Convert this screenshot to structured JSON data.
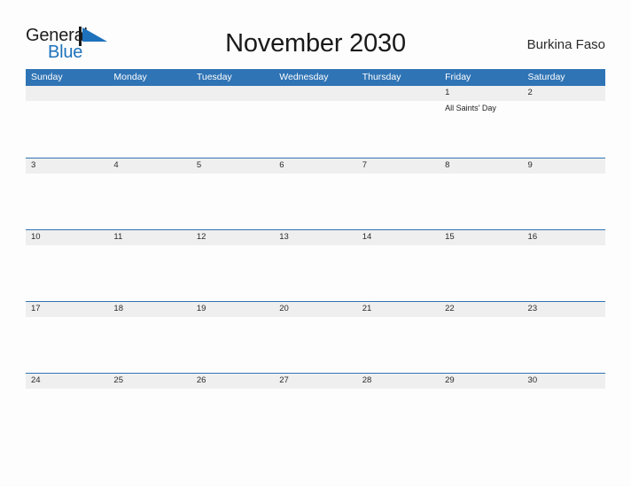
{
  "logo": {
    "text_primary": "General",
    "text_secondary": "Blue",
    "mark": "blue-flag-triangle",
    "color_primary": "#1d1d1d",
    "color_secondary": "#1d72bb"
  },
  "header": {
    "title": "November 2030",
    "country": "Burkina Faso"
  },
  "theme": {
    "accent": "#2f74b5",
    "band": "#efefef",
    "page_background": "#fdfdfd",
    "header_text": "#ffffff"
  },
  "calendar": {
    "month": "November",
    "year": "2030",
    "weekdays": [
      "Sunday",
      "Monday",
      "Tuesday",
      "Wednesday",
      "Thursday",
      "Friday",
      "Saturday"
    ],
    "weeks": [
      [
        {
          "day": "",
          "events": []
        },
        {
          "day": "",
          "events": []
        },
        {
          "day": "",
          "events": []
        },
        {
          "day": "",
          "events": []
        },
        {
          "day": "",
          "events": []
        },
        {
          "day": "1",
          "events": [
            "All Saints' Day"
          ]
        },
        {
          "day": "2",
          "events": []
        }
      ],
      [
        {
          "day": "3",
          "events": []
        },
        {
          "day": "4",
          "events": []
        },
        {
          "day": "5",
          "events": []
        },
        {
          "day": "6",
          "events": []
        },
        {
          "day": "7",
          "events": []
        },
        {
          "day": "8",
          "events": []
        },
        {
          "day": "9",
          "events": []
        }
      ],
      [
        {
          "day": "10",
          "events": []
        },
        {
          "day": "11",
          "events": []
        },
        {
          "day": "12",
          "events": []
        },
        {
          "day": "13",
          "events": []
        },
        {
          "day": "14",
          "events": []
        },
        {
          "day": "15",
          "events": []
        },
        {
          "day": "16",
          "events": []
        }
      ],
      [
        {
          "day": "17",
          "events": []
        },
        {
          "day": "18",
          "events": []
        },
        {
          "day": "19",
          "events": []
        },
        {
          "day": "20",
          "events": []
        },
        {
          "day": "21",
          "events": []
        },
        {
          "day": "22",
          "events": []
        },
        {
          "day": "23",
          "events": []
        }
      ],
      [
        {
          "day": "24",
          "events": []
        },
        {
          "day": "25",
          "events": []
        },
        {
          "day": "26",
          "events": []
        },
        {
          "day": "27",
          "events": []
        },
        {
          "day": "28",
          "events": []
        },
        {
          "day": "29",
          "events": []
        },
        {
          "day": "30",
          "events": []
        }
      ]
    ]
  }
}
